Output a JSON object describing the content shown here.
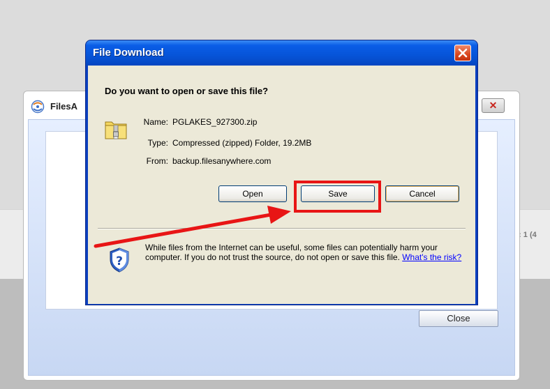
{
  "background": {
    "right_text": "l: 1 (4"
  },
  "filesanywhere_window": {
    "title": "FilesA",
    "close_label": "Close",
    "close_x": "✕"
  },
  "dialog": {
    "title": "File Download",
    "question": "Do you want to open or save this file?",
    "name_label": "Name:",
    "name_value": "PGLAKES_927300.zip",
    "type_label": "Type:",
    "type_value": "Compressed (zipped) Folder, 19.2MB",
    "from_label": "From:",
    "from_value": "backup.filesanywhere.com",
    "open_label": "Open",
    "save_label": "Save",
    "cancel_label": "Cancel",
    "warning_text": "While files from the Internet can be useful, some files can potentially harm your computer. If you do not trust the source, do not open or save this file.",
    "risk_link": "What's the risk?"
  },
  "colors": {
    "title_bar": "#0654d8",
    "dialog_body": "#ece9d8",
    "highlight": "#e81515",
    "link": "#0000ff"
  },
  "icons": {
    "zip": "zip-folder-icon",
    "shield": "security-shield-icon",
    "close": "close-icon",
    "app": "filesanywhere-logo-icon"
  }
}
